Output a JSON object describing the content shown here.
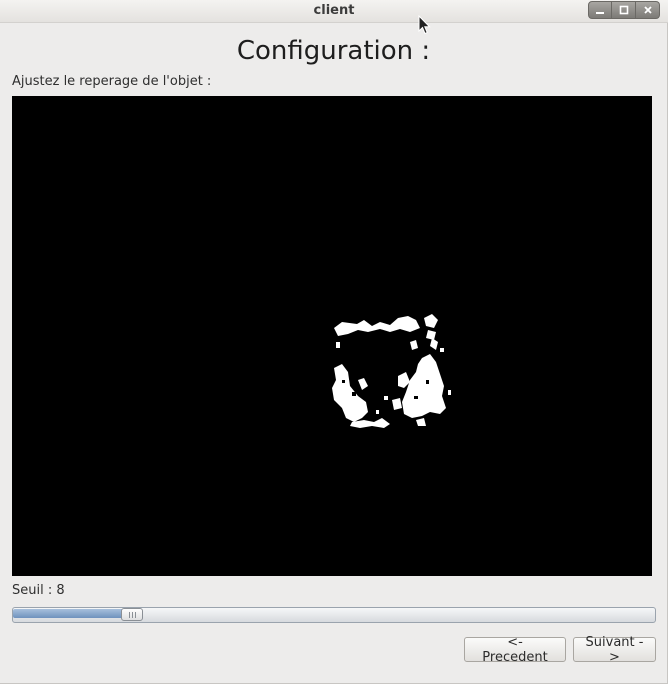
{
  "window": {
    "title": "client",
    "controls": [
      "minimize-icon",
      "maximize-icon",
      "close-icon"
    ]
  },
  "page": {
    "heading": "Configuration :",
    "instruction": "Ajustez le reperage de l'objet :"
  },
  "preview": {
    "icon": "camera-mask-image",
    "background_color": "#000000",
    "blob_color": "#ffffff"
  },
  "threshold": {
    "label": "Seuil : 8",
    "value_fraction": 0.175
  },
  "buttons": {
    "previous_label": "<- Precedent",
    "next_label": "Suivant ->"
  },
  "colors": {
    "window_bg": "#edeceb",
    "slider_fill": "#6f92bd"
  }
}
